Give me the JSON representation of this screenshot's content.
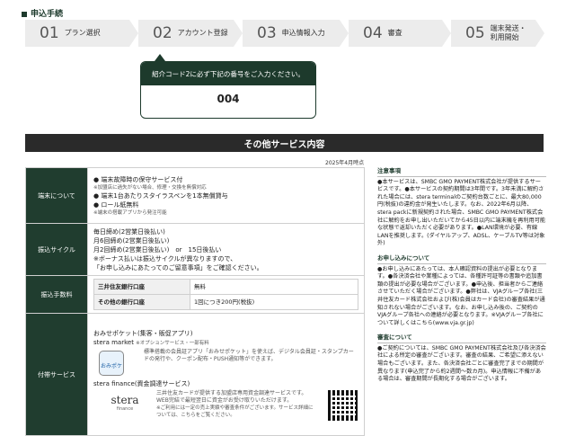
{
  "header": {
    "title": "申込手続"
  },
  "steps": [
    {
      "num": "01",
      "label": "プラン選択"
    },
    {
      "num": "02",
      "label": "アカウント登録"
    },
    {
      "num": "03",
      "label": "申込情報入力"
    },
    {
      "num": "04",
      "label": "審査"
    },
    {
      "num": "05",
      "label1": "端末発送・",
      "label2": "利用開始"
    }
  ],
  "callout": {
    "text": "紹介コード2に必ず下記の番号をご入力ください。",
    "code": "004"
  },
  "section": {
    "title": "その他サービス内容",
    "date": "2025年4月時点"
  },
  "rows": {
    "terminal": {
      "head": "端末について",
      "items": [
        "端末故障時の保守サービス付",
        "端末1台あたりスタイラスペンを1本無償貸与",
        "ロール紙無料"
      ],
      "note1": "※加盟店に過失がない場合、修理・交換を無償対応",
      "note3": "※端末の搭載アプリから発注可能"
    },
    "cycle": {
      "head": "振込サイクル",
      "lines": [
        "毎日締め(2営業日後払い)",
        "月6回締め(2営業日後払い)",
        "月2回締め(2営業日後払い)　or　15日後払い",
        "※ボーナス払いは振込サイクルが異なりますので、",
        "「お申し込みにあたってのご留意事項」をご確認ください。"
      ]
    },
    "fee": {
      "head": "振込手数料",
      "bank1": "三井住友銀行口座",
      "val1": "無料",
      "bank2": "その他の銀行口座",
      "val2": "1回につき200円(税抜)"
    },
    "addon": {
      "head": "付帯サービス",
      "title1": "おみせポケット(集客・販促アプリ)",
      "sub1a": "stera market",
      "sub1b": "※オプションサービス・一部有料",
      "app_label": "おみポケ",
      "desc1": "標準搭載の会員証アプリ「おみせポケット」を使えば、デジタル会員証・スタンプカードの発行や、クーポン配布・PUSH通知等ができます。",
      "title2": "stera finance(資金調達サービス)",
      "logo": "stera",
      "logo_sub": "finance",
      "desc2": "三井住友カードが提供する加盟店専用資金調達サービスです。WEB完結で最短翌日に資金がお受け取りいただけます。",
      "note2": "※ご利用には一定の売上実績や審査条件がございます。サービス詳細については、こちらをご覧ください。"
    }
  },
  "side": {
    "sec1_title": "注意事項",
    "sec1_text": "●本サービスは、SMBC GMO PAYMENT株式会社が提供するサービスです。●本サービスの契約期間は3年間です。3年未満に解約された場合には、stera terminalのご契約台数ごとに、最大80,000円(税抜)の違約金が発生いたします。なお、2022年6月以降、stera packに新規契約された場合、SMBC GMO PAYMENT株式会社に解約をお申し出いただいてから45日以内に端末機を再利用可能な状態で返却いただく必要があります。●LAN環境が必要、有線LANを推奨します。(ダイヤルアップ、ADSL、ケーブルTV等は対象外)",
    "sec2_title": "お申し込みについて",
    "sec2_text": "●お申し込みにあたっては、本人確認資料の提出が必要となります。●各決済会社や業種によっては、各種許可証等の書類や追加書類の提出が必要な場合がございます。●申込後、担当者からご連絡させていただく場合がございます。●弊社は、VJAグループ各社(三井住友カード株式会社および(株)会員はカード会社)の審査結果が通知されない場合がございます。なお、お申し込み後の、ご契約のVJAグループ各社への連絡が必要となります。※VJAグループ各社について詳しくはこちら(www.vja.gr.jp)",
    "sec3_title": "審査について",
    "sec3_text": "●ご契約については、SMBC GMO PAYMENT株式会社及び各決済会社による所定の審査がございます。審査の結果、ご希望に添えない場合もございます。また、各決済会社ごとに審査完了までの期間が異なります(申込完了から約2週間〜数カ月)。申込情報に不備がある場合は、審査期間が長期化する場合がございます。"
  }
}
